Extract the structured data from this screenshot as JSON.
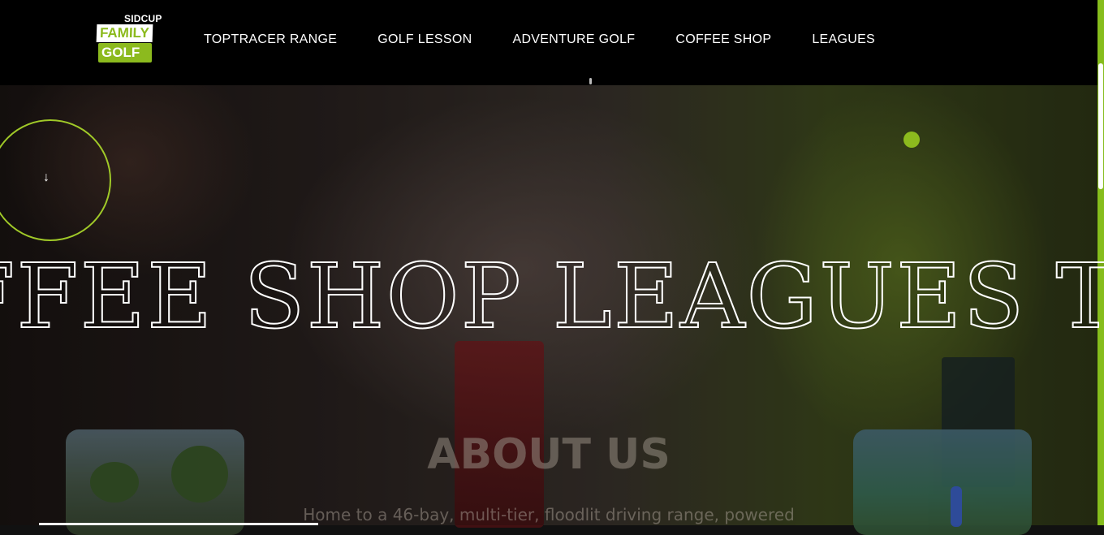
{
  "header": {
    "logo": {
      "top": "SIDCUP",
      "line1": "FAMILY",
      "line2": "GOLF"
    },
    "nav": [
      {
        "label": "TOPTRACER RANGE"
      },
      {
        "label": "GOLF LESSON"
      },
      {
        "label": "ADVENTURE GOLF"
      },
      {
        "label": "COFFEE SHOP"
      },
      {
        "label": "LEAGUES"
      }
    ]
  },
  "hero": {
    "scroll_arrow": "↓",
    "marquee_text": "FFEE SHOP LEAGUES TO"
  },
  "about": {
    "title": "ABOUT US",
    "text": "Home to a 46-bay, multi-tier, floodlit driving range, powered"
  },
  "colors": {
    "brand_green": "#8cba1e",
    "header_bg": "#000000"
  }
}
